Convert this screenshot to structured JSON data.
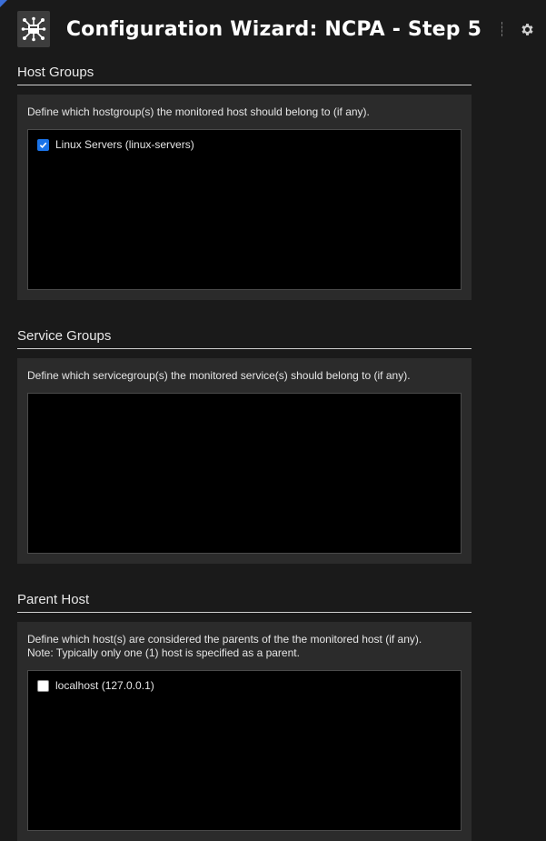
{
  "header": {
    "title": "Configuration Wizard: NCPA - Step 5",
    "icon": "network-node-icon",
    "settings_icon": "gear-icon"
  },
  "colors": {
    "background": "#1a1a1a",
    "panel": "#2b2b2b",
    "list_box": "#000000",
    "checkbox_checked": "#1a73e8"
  },
  "host_groups": {
    "title": "Host Groups",
    "description": "Define which hostgroup(s) the monitored host should belong to (if any).",
    "items": [
      {
        "label": "Linux Servers (linux-servers)",
        "checked": true
      }
    ]
  },
  "service_groups": {
    "title": "Service Groups",
    "description": "Define which servicegroup(s) the monitored service(s) should belong to (if any).",
    "items": []
  },
  "parent_host": {
    "title": "Parent Host",
    "description_line1": "Define which host(s) are considered the parents of the the monitored host (if any).",
    "description_line2": "Note: Typically only one (1) host is specified as a parent.",
    "items": [
      {
        "label": "localhost (127.0.0.1)",
        "checked": false
      }
    ]
  }
}
